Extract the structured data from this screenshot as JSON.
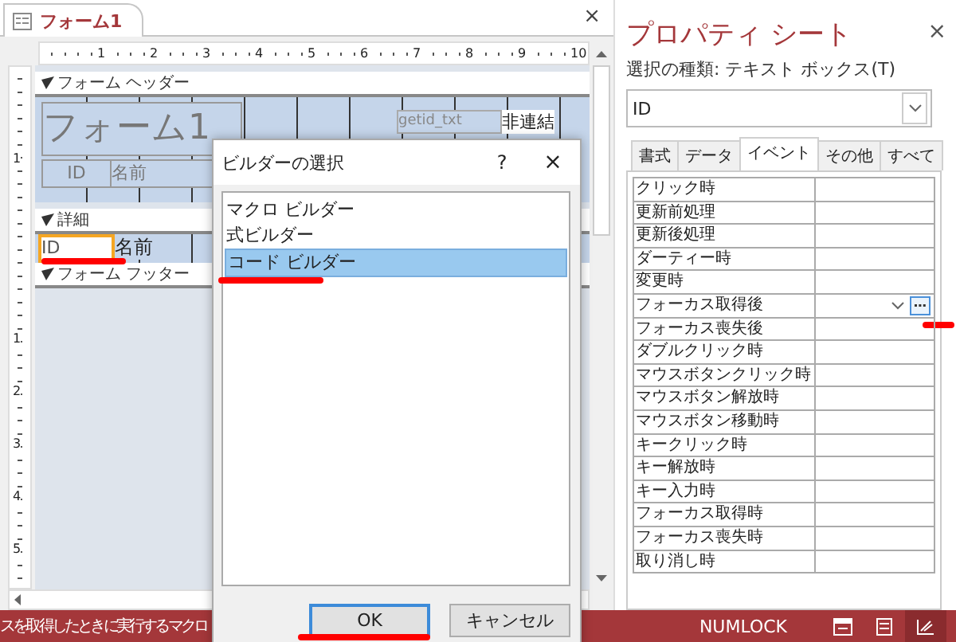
{
  "document_tab": {
    "title": "フォーム1",
    "close": "×"
  },
  "ruler": {
    "top_marks": [
      "1",
      "2",
      "3",
      "4",
      "5",
      "6",
      "7",
      "8",
      "9",
      "10"
    ],
    "header_marks": [
      "1"
    ],
    "body_marks": [
      "1",
      "2",
      "3",
      "4",
      "5"
    ]
  },
  "form_header": {
    "label": "フォーム ヘッダー",
    "title": "フォーム1",
    "textbox": "getid_txt",
    "textbox_value": "非連結",
    "labels": [
      "ID",
      "名前"
    ]
  },
  "detail": {
    "label": "詳細",
    "textbox": "ID",
    "textbox_selected": true,
    "name_label": "名前"
  },
  "form_footer": {
    "label": "フォーム フッター"
  },
  "property_sheet": {
    "title": "プロパティ シート",
    "close": "×",
    "selection_type": "選択の種類: テキスト ボックス(T)",
    "object": "ID",
    "tabs": [
      {
        "label": "書式",
        "selected": false
      },
      {
        "label": "データ",
        "selected": false
      },
      {
        "label": "イベント",
        "selected": true
      },
      {
        "label": "その他",
        "selected": false
      },
      {
        "label": "すべて",
        "selected": false
      }
    ],
    "rows": [
      {
        "label": "クリック時",
        "active": false
      },
      {
        "label": "更新前処理",
        "active": false
      },
      {
        "label": "更新後処理",
        "active": false
      },
      {
        "label": "ダーティー時",
        "active": false
      },
      {
        "label": "変更時",
        "active": false
      },
      {
        "label": "フォーカス取得後",
        "active": true
      },
      {
        "label": "フォーカス喪失後",
        "active": false
      },
      {
        "label": "ダブルクリック時",
        "active": false
      },
      {
        "label": "マウスボタンクリック時",
        "active": false
      },
      {
        "label": "マウスボタン解放時",
        "active": false
      },
      {
        "label": "マウスボタン移動時",
        "active": false
      },
      {
        "label": "キークリック時",
        "active": false
      },
      {
        "label": "キー解放時",
        "active": false
      },
      {
        "label": "キー入力時",
        "active": false
      },
      {
        "label": "フォーカス取得時",
        "active": false
      },
      {
        "label": "フォーカス喪失時",
        "active": false
      },
      {
        "label": "取り消し時",
        "active": false
      }
    ]
  },
  "dialog": {
    "title": "ビルダーの選択",
    "help": "?",
    "close": "×",
    "items": [
      {
        "label": "マクロ ビルダー",
        "selected": false
      },
      {
        "label": "式ビルダー",
        "selected": false
      },
      {
        "label": "コード ビルダー",
        "selected": true
      }
    ],
    "buttons": [
      {
        "label": "OK",
        "default": true
      },
      {
        "label": "キャンセル",
        "default": false
      }
    ]
  },
  "status_bar": {
    "message": "スを取得したときに実行するマクロ",
    "indicator": "NUMLOCK"
  }
}
